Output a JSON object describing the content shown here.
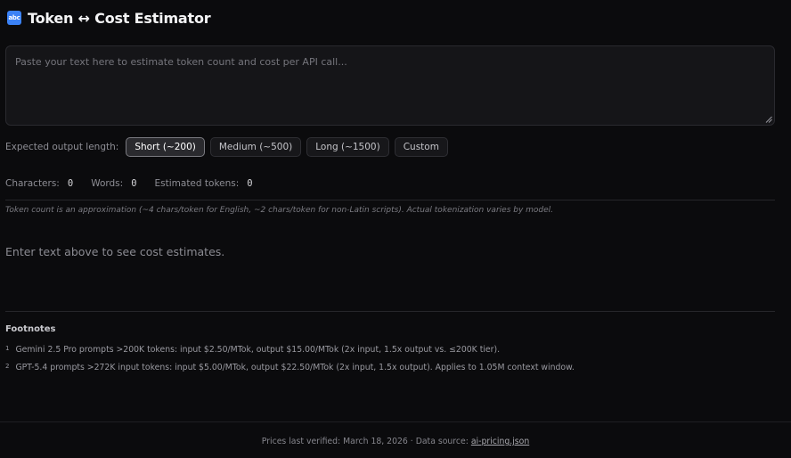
{
  "header": {
    "icon_label": "abc",
    "title": "Token ↔ Cost Estimator"
  },
  "input": {
    "placeholder": "Paste your text here to estimate token count and cost per API call...",
    "value": ""
  },
  "output_length": {
    "label": "Expected output length:",
    "options": [
      {
        "label": "Short (~200)",
        "selected": true
      },
      {
        "label": "Medium (~500)",
        "selected": false
      },
      {
        "label": "Long (~1500)",
        "selected": false
      },
      {
        "label": "Custom",
        "selected": false
      }
    ]
  },
  "stats": {
    "characters_label": "Characters:",
    "characters_value": "0",
    "words_label": "Words:",
    "words_value": "0",
    "tokens_label": "Estimated tokens:",
    "tokens_value": "0"
  },
  "note": "Token count is an approximation (~4 chars/token for English, ~2 chars/token for non-Latin scripts). Actual tokenization varies by model.",
  "empty_message": "Enter text above to see cost estimates.",
  "footnotes": {
    "title": "Footnotes",
    "items": [
      {
        "marker": "1",
        "text": "Gemini 2.5 Pro prompts >200K tokens: input $2.50/MTok, output $15.00/MTok (2x input, 1.5x output vs. ≤200K tier)."
      },
      {
        "marker": "2",
        "text": "GPT-5.4 prompts >272K input tokens: input $5.00/MTok, output $22.50/MTok (2x input, 1.5x output). Applies to 1.05M context window."
      }
    ]
  },
  "footer": {
    "prefix": "Prices last verified: March 18, 2026 · Data source: ",
    "link_text": "ai-pricing.json"
  }
}
